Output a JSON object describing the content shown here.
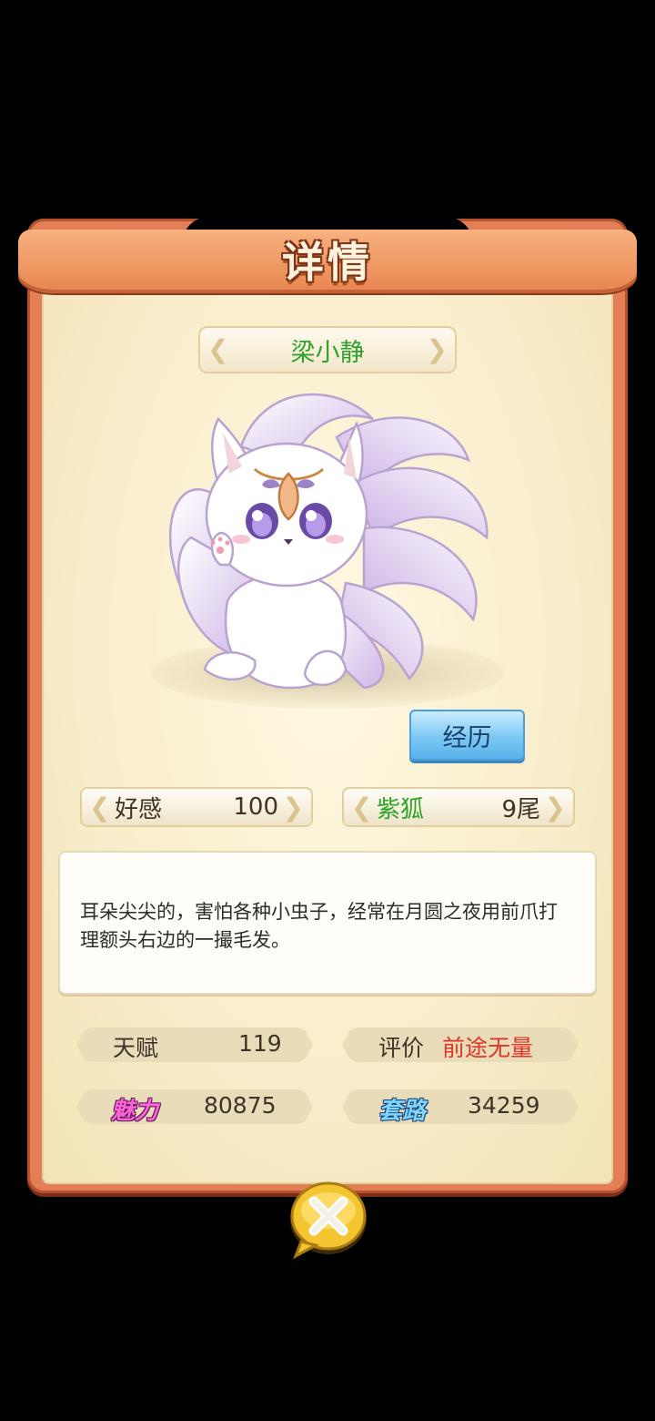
{
  "dialog": {
    "title": "详情"
  },
  "pet": {
    "name": "梁小静",
    "history_button": "经历",
    "affection_label": "好感",
    "affection_value": "100",
    "breed_label": "紫狐",
    "breed_value": "9尾",
    "description": "耳朵尖尖的，害怕各种小虫子，经常在月圆之夜用前爪打理额头右边的一撮毛发。"
  },
  "stats": {
    "talent_label": "天赋",
    "talent_value": "119",
    "rating_label": "评价",
    "rating_value": "前途无量",
    "charm_label": "魅力",
    "charm_value": "80875",
    "trick_label": "套路",
    "trick_value": "34259"
  },
  "colors": {
    "name_green": "#2ea32a",
    "rating_red": "#e0362a",
    "frame_orange": "#e27f56",
    "panel_cream": "#f8edca"
  },
  "icons": {
    "close": "close-x-icon",
    "chevron": "chevron-icon"
  }
}
